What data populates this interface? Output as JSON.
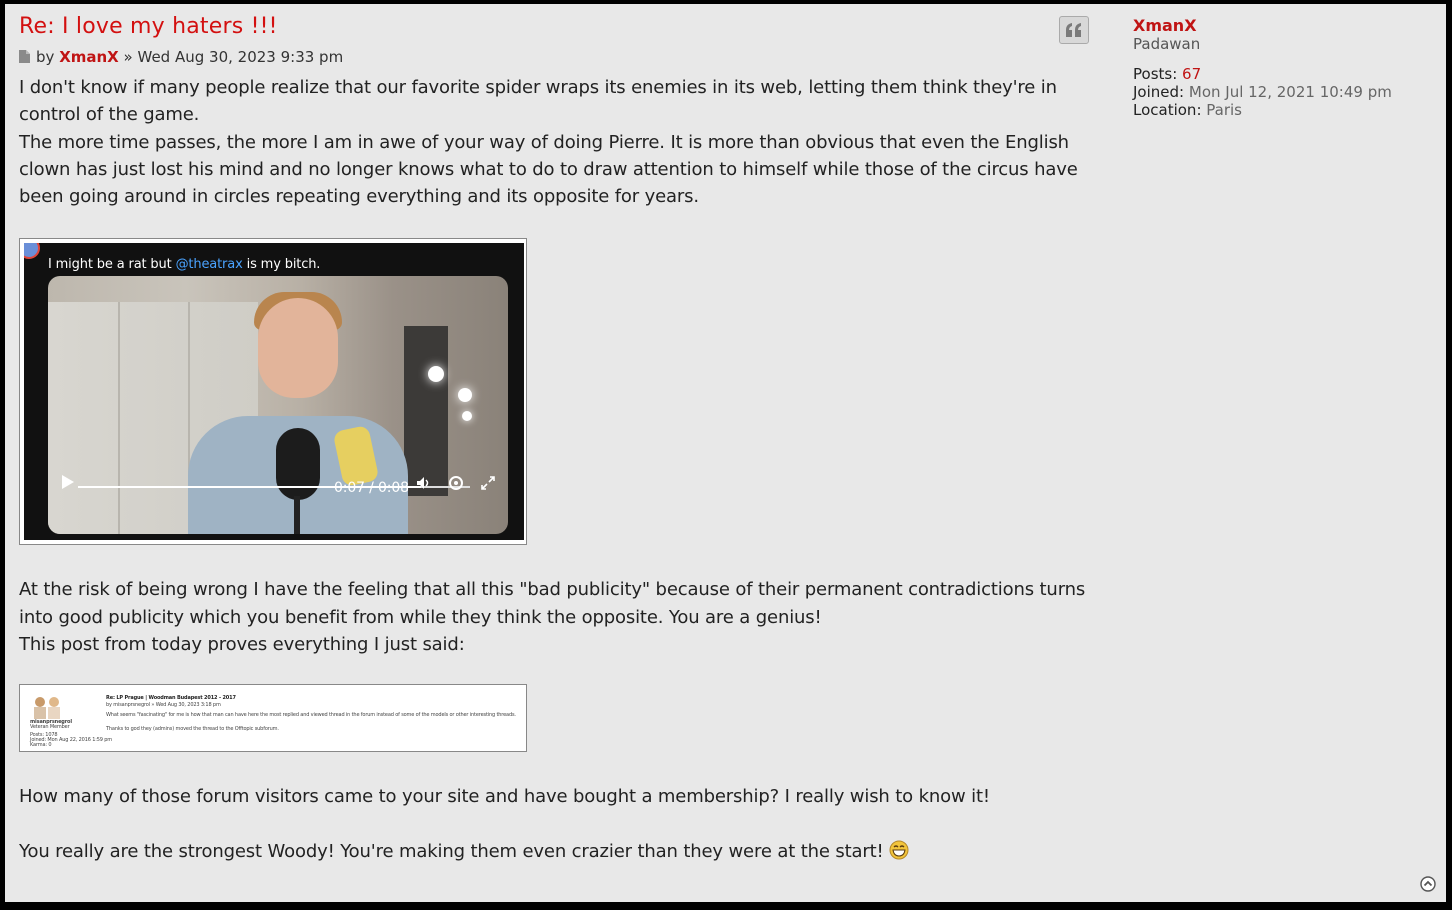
{
  "post": {
    "title": "Re: I love my haters !!!",
    "by_label": "by",
    "author": "XmanX",
    "separator": "»",
    "datetime": "Wed Aug 30, 2023 9:33 pm",
    "paragraph1_line1": "I don't know if many people realize that our favorite spider wraps its enemies in its web, letting them think they're in",
    "paragraph1_line2": "control of the game.",
    "paragraph2_line1": "The more time passes, the more I am in awe of your way of doing Pierre. It is more than obvious that even the English",
    "paragraph2_line2": "clown has just lost his mind and no longer knows what to do to draw attention to himself while those of the circus have",
    "paragraph2_line3": "been going around in circles repeating everything and its opposite for years.",
    "video": {
      "caption_prefix": "I might be a rat but ",
      "caption_mention": "@theatrax",
      "caption_suffix": " is my bitch.",
      "time": "0:07 / 0:08",
      "progress": 0.875
    },
    "paragraph3_line1": "At the risk of being wrong I have the feeling that all this \"bad publicity\" because of their permanent contradictions turns",
    "paragraph3_line2": "into good publicity which you benefit from while they think the opposite. You are a genius!",
    "paragraph3_line3": "This post from today proves everything I just said:",
    "screenshot": {
      "title": "Re: LP Prague | Woodman Budapest 2012 - 2017",
      "by_line": "by misanprsnegrol » Wed Aug 30, 2023 3:18 pm",
      "body1": "What seems \"fascinating\" for me is how that man can have here the most replied and viewed thread in the forum instead of some of the models or other interesting threads.",
      "body2": "Thanks to god they (admins) moved the thread to the Offtopic subforum.",
      "user": "misanprsnegrol",
      "rank": "Veteran Member",
      "stat1": "Posts: 1078",
      "stat2": "Joined: Mon Aug 22, 2016 1:59 pm",
      "stat3": "Karma: 0"
    },
    "paragraph4": "How many of those forum visitors came to your site and have bought a membership? I really wish to know it!",
    "paragraph5": "You really are the strongest Woody! You're making them even crazier than they were at the start!"
  },
  "profile": {
    "name": "XmanX",
    "rank": "Padawan",
    "posts_label": "Posts:",
    "posts_value": "67",
    "joined_label": "Joined:",
    "joined_value": "Mon Jul 12, 2021 10:49 pm",
    "location_label": "Location:",
    "location_value": "Paris"
  },
  "icons": {
    "quote": "quote-icon",
    "post": "document-icon",
    "top": "arrow-up-circle-icon",
    "emoji": "grinning-face-emoji"
  }
}
